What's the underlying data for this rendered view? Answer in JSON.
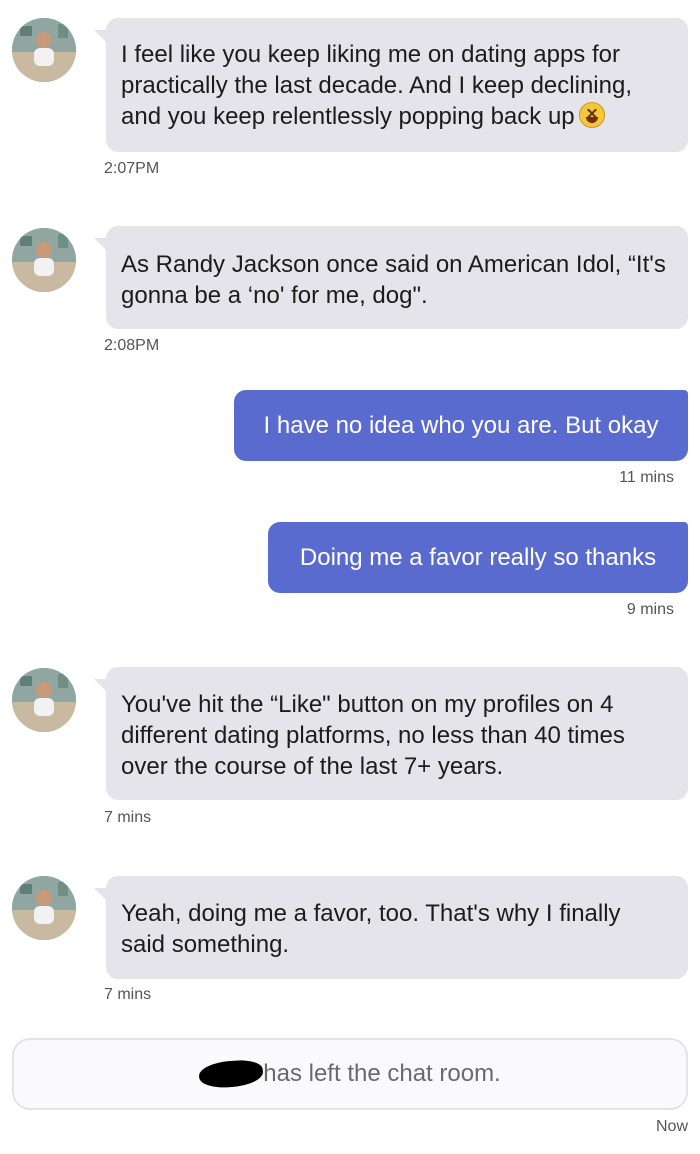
{
  "messages": [
    {
      "side": "in",
      "text": "I feel like you keep liking me on dating apps for practically the last decade. And I keep declining, and you keep relentlessly popping back up",
      "emoji": "grinning-squinting-face",
      "time": "2:07PM"
    },
    {
      "side": "in",
      "text": "As Randy Jackson once said on American Idol, “It's gonna be a ‘no' for me, dog\".",
      "time": "2:08PM"
    },
    {
      "side": "out",
      "text": "I have no idea who you are. But okay",
      "time": "11 mins"
    },
    {
      "side": "out",
      "text": "Doing me a favor really so thanks",
      "time": "9 mins"
    },
    {
      "side": "in",
      "text": "You've hit the “Like\" button on my profiles on 4 different dating platforms, no less than 40 times over the course of the last 7+ years.",
      "time": "7 mins"
    },
    {
      "side": "in",
      "text": "Yeah, doing me a favor, too. That's why I finally said something.",
      "time": "7 mins"
    }
  ],
  "system_notice": {
    "text": "has left the chat room.",
    "time": "Now"
  },
  "colors": {
    "incoming_bubble": "#e4e4ea",
    "outgoing_bubble": "#5a6bd0",
    "outgoing_text": "#ffffff"
  }
}
